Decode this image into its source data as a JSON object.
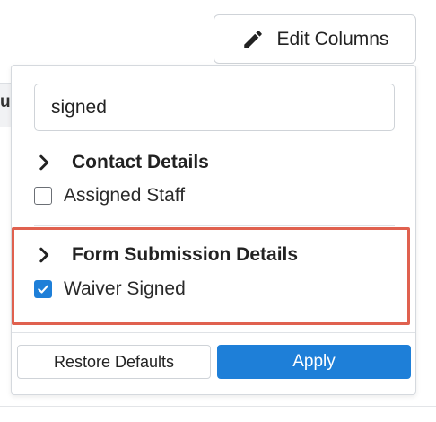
{
  "toolbar": {
    "edit_columns_label": "Edit Columns",
    "edit_icon": "pencil-icon"
  },
  "background": {
    "partial_header_char": "u"
  },
  "column_picker": {
    "search": {
      "value": "signed",
      "placeholder": ""
    },
    "groups": [
      {
        "title": "Contact Details",
        "icon": "chevron-right-icon",
        "options": [
          {
            "label": "Assigned Staff",
            "checked": false
          }
        ]
      },
      {
        "title": "Form Submission Details",
        "icon": "chevron-right-icon",
        "options": [
          {
            "label": "Waiver Signed",
            "checked": true
          }
        ]
      }
    ],
    "restore_label": "Restore Defaults",
    "apply_label": "Apply"
  },
  "colors": {
    "accent": "#1e7fd8",
    "highlight": "#e0614f"
  }
}
